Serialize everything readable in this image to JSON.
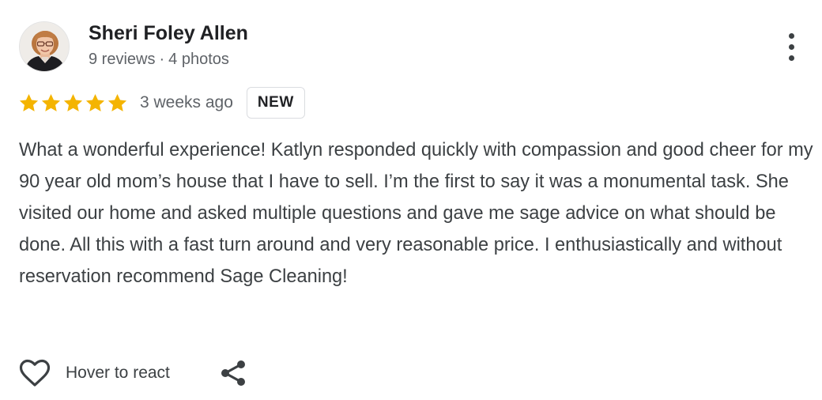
{
  "reviewer": {
    "name": "Sheri Foley Allen",
    "reviews_count": "9 reviews",
    "separator": "·",
    "photos_count": "4 photos",
    "avatar_icon": "avatar-photo"
  },
  "menu": {
    "icon": "more-vert-icon"
  },
  "rating": {
    "stars": 5,
    "max_stars": 5,
    "star_color": "#f4b400",
    "time_ago": "3 weeks ago",
    "badge": "NEW"
  },
  "review": {
    "text": "What a wonderful experience! Katlyn responded quickly with compassion and good cheer for my 90 year old mom’s house that I have to sell. I’m the first to say it was a monumental task. She visited our home and asked multiple questions and gave me sage advice on what should be done. All this with a fast turn around and very reasonable price. I enthusiastically and without reservation recommend Sage Cleaning!"
  },
  "actions": {
    "react_label": "Hover to react",
    "react_icon": "heart-outline-icon",
    "share_icon": "share-icon"
  }
}
